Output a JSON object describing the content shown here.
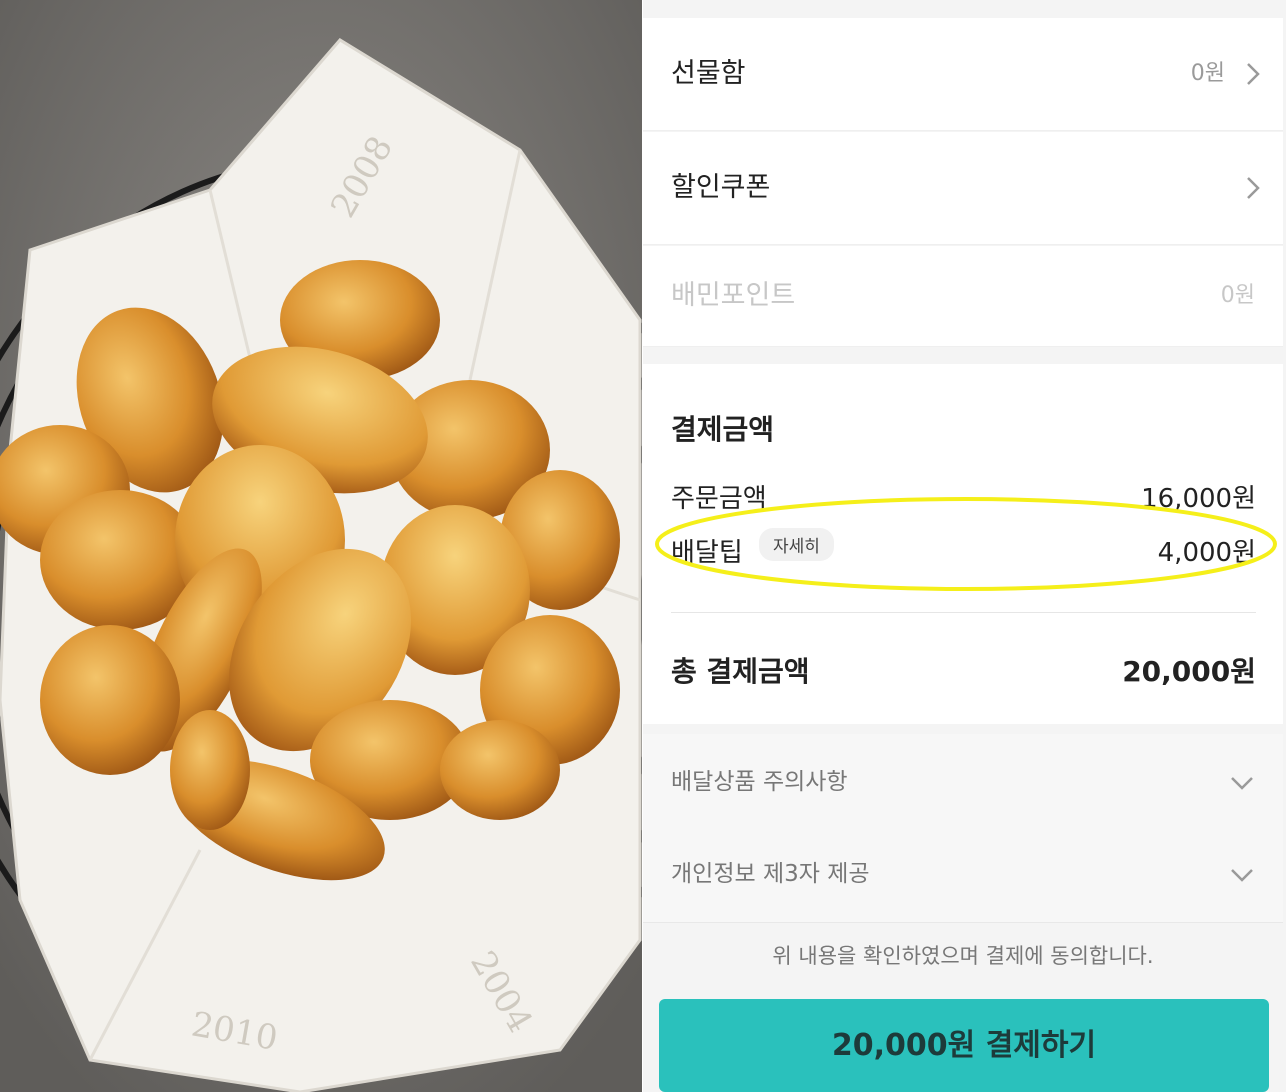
{
  "payment_options": [
    {
      "label": "선물함",
      "value": "0원",
      "has_chevron": true,
      "disabled": false
    },
    {
      "label": "할인쿠폰",
      "value": "",
      "has_chevron": true,
      "disabled": false
    },
    {
      "label": "배민포인트",
      "value": "0원",
      "has_chevron": false,
      "disabled": true
    }
  ],
  "summary": {
    "title": "결제금액",
    "order_label": "주문금액",
    "order_value": "16,000원",
    "delivery_label": "배달팁",
    "delivery_detail_badge": "자세히",
    "delivery_value": "4,000원",
    "total_label": "총 결제금액",
    "total_value": "20,000원"
  },
  "notices": [
    {
      "label": "배달상품 주의사항",
      "icon": "chevron-down-icon"
    },
    {
      "label": "개인정보 제3자 제공",
      "icon": "chevron-down-icon"
    }
  ],
  "agreement_text": "위 내용을 확인하였으며 결제에 동의합니다.",
  "pay_button_label": "20,000원 결제하기",
  "colors": {
    "accent": "#2ac1bc",
    "highlight_ring": "#f5ef1a"
  }
}
